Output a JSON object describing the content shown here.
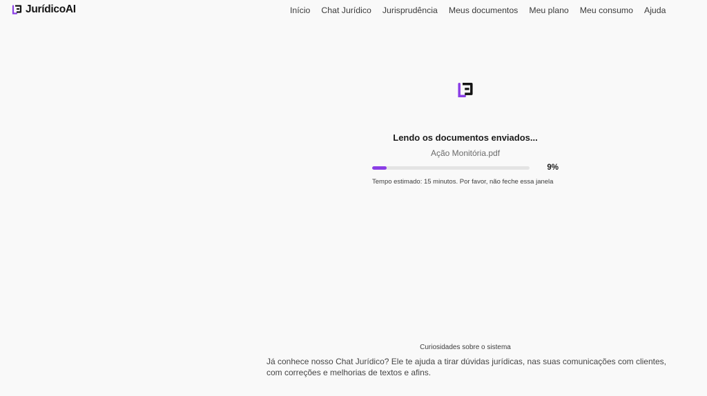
{
  "app": {
    "brand_name": "JurídicoAI",
    "logo_icon": "juridico-logo-icon",
    "accent_color": "#8b3fe6"
  },
  "nav": {
    "items": [
      {
        "label": "Início"
      },
      {
        "label": "Chat Jurídico"
      },
      {
        "label": "Jurisprudência"
      },
      {
        "label": "Meus documentos"
      },
      {
        "label": "Meu plano"
      },
      {
        "label": "Meu consumo"
      },
      {
        "label": "Ajuda"
      }
    ]
  },
  "loading": {
    "title": "Lendo os documentos enviados...",
    "file_name": "Ação Monitória.pdf",
    "progress_percent": 9,
    "progress_label": "9%",
    "estimate_text": "Tempo estimado: 15 minutos. Por favor, não feche essa janela"
  },
  "curiosities": {
    "heading": "Curiosidades sobre o sistema",
    "text": "Já conhece nosso Chat Jurídico? Ele te ajuda a tirar dúvidas jurídicas, nas suas comunicações com clientes, com correções e melhorias de textos e afins."
  }
}
